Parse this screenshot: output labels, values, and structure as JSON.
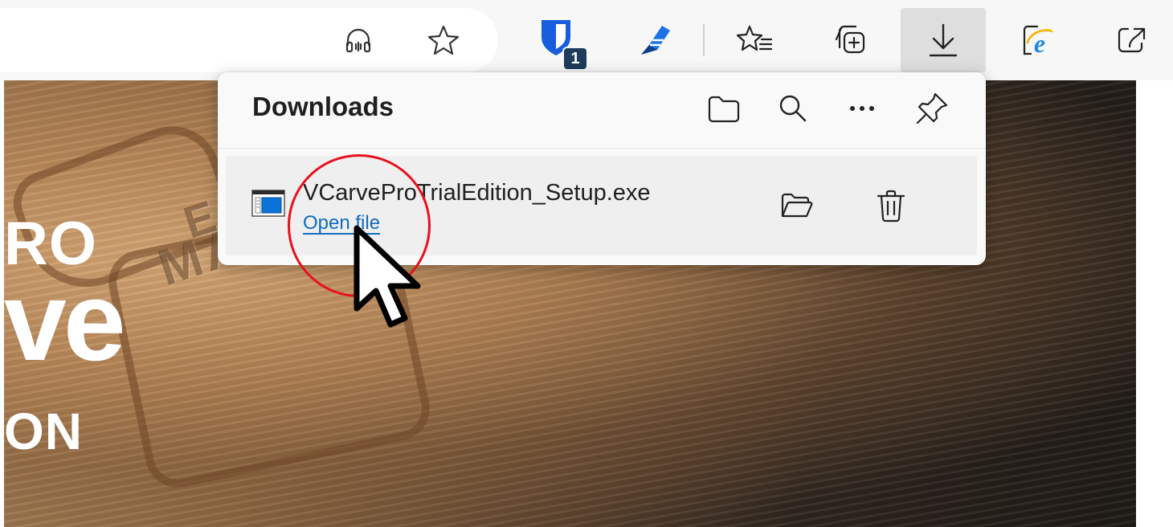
{
  "toolbar": {
    "icons": [
      "read-aloud-icon",
      "favorite-star-icon",
      "bitwarden-extension-icon",
      "pen-extension-icon",
      "favorites-list-icon",
      "collections-icon",
      "downloads-icon",
      "ie-mode-icon",
      "share-icon"
    ],
    "extension_badge": "1"
  },
  "page": {
    "hero_line1": "RO",
    "hero_line2": "ve",
    "hero_line3": "ON",
    "engraving_1": "E",
    "engraving_2": "MAR"
  },
  "downloads": {
    "title": "Downloads",
    "header_actions": [
      "open-downloads-folder-icon",
      "search-icon",
      "more-options-icon",
      "pin-icon"
    ],
    "items": [
      {
        "file_name": "VCarveProTrialEdition_Setup.exe",
        "action_label": "Open file",
        "actions": [
          "show-in-folder-icon",
          "delete-icon"
        ]
      }
    ]
  },
  "colors": {
    "link": "#0f6cbd",
    "highlight_circle": "#e8101c",
    "badge_bg": "#1d3b5a",
    "active_button_bg": "#dedede"
  }
}
